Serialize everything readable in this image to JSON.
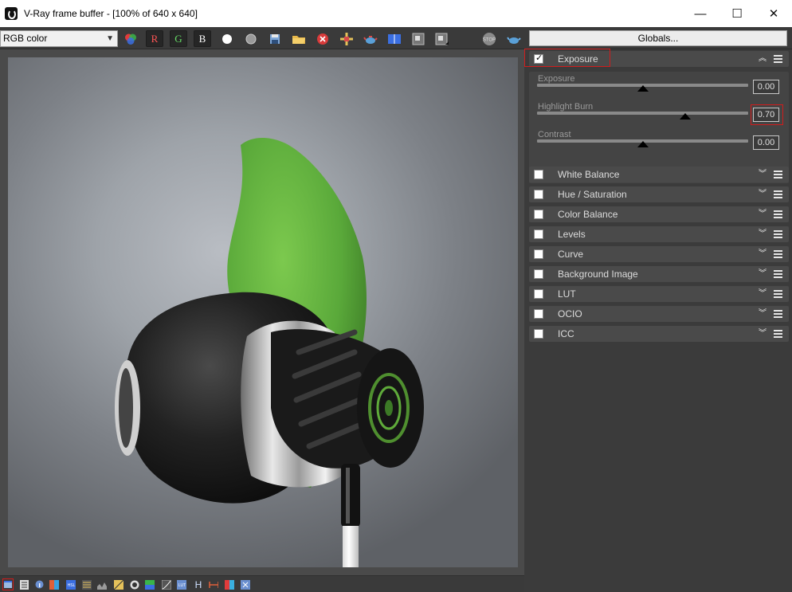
{
  "window": {
    "title": "V-Ray frame buffer - [100% of 640 x 640]",
    "minimize": "—",
    "maximize": "☐",
    "close": "✕"
  },
  "toolbar": {
    "channel": "RGB color",
    "red": "R",
    "green": "G",
    "blue": "B",
    "globals": "Globals..."
  },
  "panel": {
    "exposure": {
      "label": "Exposure",
      "checked": true,
      "sliders": [
        {
          "label": "Exposure",
          "value": "0.00",
          "position": 0.5
        },
        {
          "label": "Highlight Burn",
          "value": "0.70",
          "position": 0.7
        },
        {
          "label": "Contrast",
          "value": "0.00",
          "position": 0.5
        }
      ]
    },
    "sections": [
      {
        "label": "White Balance"
      },
      {
        "label": "Hue / Saturation"
      },
      {
        "label": "Color Balance"
      },
      {
        "label": "Levels"
      },
      {
        "label": "Curve"
      },
      {
        "label": "Background Image"
      },
      {
        "label": "LUT"
      },
      {
        "label": "OCIO"
      },
      {
        "label": "ICC"
      }
    ]
  },
  "colors": {
    "highlight": "#d11c1c",
    "object_green": "#5faa3a"
  },
  "statusbar": {
    "hist": "H"
  }
}
